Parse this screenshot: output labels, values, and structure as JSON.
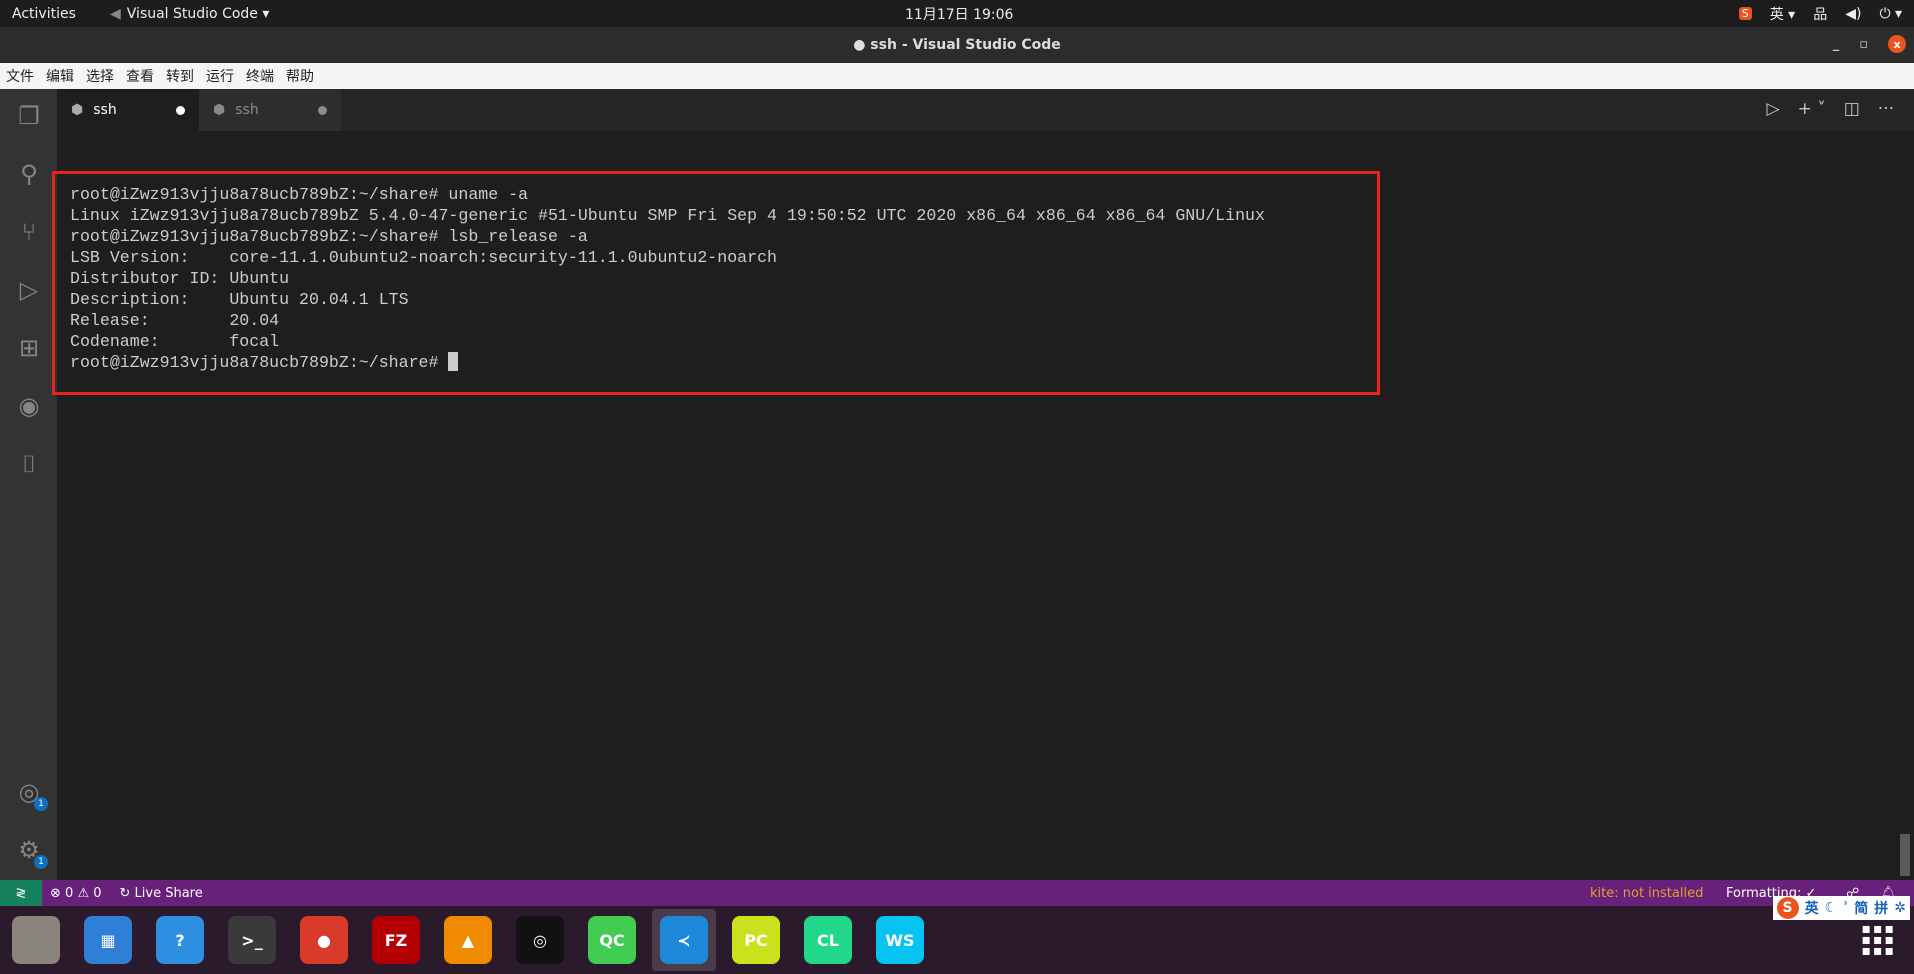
{
  "topbar": {
    "activities": "Activities",
    "app": "Visual Studio Code ▾",
    "clock": "11月17日  19:06",
    "lang": "英 ▾"
  },
  "window": {
    "title": "● ssh - Visual Studio Code",
    "close": "x"
  },
  "menu": [
    "文件",
    "编辑",
    "选择",
    "查看",
    "转到",
    "运行",
    "终端",
    "帮助"
  ],
  "tabs": [
    {
      "label": "ssh",
      "active": true,
      "dirty": true
    },
    {
      "label": "ssh",
      "active": false,
      "dirty": true
    }
  ],
  "activity_badges": {
    "accounts": "1",
    "settings": "1"
  },
  "terminal": {
    "lines": [
      "root@iZwz913vjju8a78ucb789bZ:~/share# uname -a",
      "Linux iZwz913vjju8a78ucb789bZ 5.4.0-47-generic #51-Ubuntu SMP Fri Sep 4 19:50:52 UTC 2020 x86_64 x86_64 x86_64 GNU/Linux",
      "root@iZwz913vjju8a78ucb789bZ:~/share# lsb_release -a",
      "LSB Version:    core-11.1.0ubuntu2-noarch:security-11.1.0ubuntu2-noarch",
      "Distributor ID: Ubuntu",
      "Description:    Ubuntu 20.04.1 LTS",
      "Release:        20.04",
      "Codename:       focal"
    ],
    "prompt": "root@iZwz913vjju8a78ucb789bZ:~/share# "
  },
  "status": {
    "errors": "0",
    "warnings": "0",
    "live_share": "Live Share",
    "kite": "kite: not installed",
    "formatting": "Formatting: ✓"
  },
  "ime": {
    "lang": "英",
    "simplified": "简",
    "pinyin": "拼"
  },
  "dock": [
    {
      "name": "files",
      "label": "",
      "color": "#8a857a"
    },
    {
      "name": "software",
      "label": "▦",
      "color": "#2f7fd6"
    },
    {
      "name": "help",
      "label": "?",
      "color": "#2f8fe0"
    },
    {
      "name": "terminal",
      "label": ">_",
      "color": "#3a3a3a"
    },
    {
      "name": "chrome",
      "label": "●",
      "color": "#d93b2b"
    },
    {
      "name": "filezilla",
      "label": "FZ",
      "color": "#b40000"
    },
    {
      "name": "vlc",
      "label": "▲",
      "color": "#f08a00"
    },
    {
      "name": "obs",
      "label": "◎",
      "color": "#111111"
    },
    {
      "name": "qtcreator",
      "label": "QC",
      "color": "#41cd52"
    },
    {
      "name": "vscode",
      "label": "≺",
      "color": "#1e88d8"
    },
    {
      "name": "pycharm",
      "label": "PC",
      "color": "#c8e31d"
    },
    {
      "name": "clion",
      "label": "CL",
      "color": "#21d789"
    },
    {
      "name": "webstorm",
      "label": "WS",
      "color": "#07c3f2"
    }
  ]
}
